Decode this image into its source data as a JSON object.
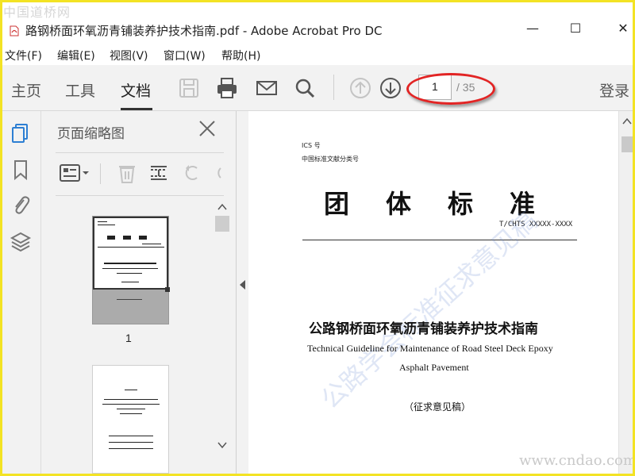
{
  "watermark_logo": "中国道桥网",
  "window": {
    "title": "路钢桥面环氧沥青铺装养护技术指南.pdf - Adobe Acrobat Pro DC",
    "minimize": "—",
    "maximize": "☐",
    "close": "✕"
  },
  "menu": [
    {
      "label": "文件(F)"
    },
    {
      "label": "编辑(E)"
    },
    {
      "label": "视图(V)"
    },
    {
      "label": "窗口(W)"
    },
    {
      "label": "帮助(H)"
    }
  ],
  "toolbar": {
    "tabs": [
      {
        "label": "主页"
      },
      {
        "label": "工具"
      },
      {
        "label": "文档"
      }
    ],
    "page_current": "1",
    "page_total": "/ 35",
    "login": "登录"
  },
  "thumbnail_pane": {
    "title": "页面缩略图",
    "page_number": "1"
  },
  "document": {
    "ics": "ICS 号",
    "classification": "中国标准文献分类号",
    "heading": "团体标准",
    "code": "T/CHTS XXXXX-XXXX",
    "title_cn": "公路钢桥面环氧沥青铺装养护技术指南",
    "title_en_line1": "Technical Guideline for Maintenance of Road Steel Deck Epoxy",
    "title_en_line2": "Asphalt Pavement",
    "draft": "（征求意见稿）",
    "watermark": "公路学会标准征求意见稿"
  },
  "site_watermark": "www.cndao.com",
  "colors": {
    "frame": "#f3e324",
    "highlight_ellipse": "#e22424",
    "sidebar_active_icon": "#2d7fd3",
    "toolbar_bg": "#f2f2f2"
  }
}
